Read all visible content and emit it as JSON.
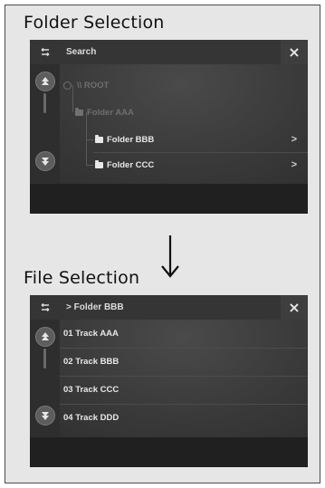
{
  "folder_section": {
    "title": "Folder Selection",
    "screen": {
      "header_title": "Search",
      "close_label": "×",
      "tree": [
        {
          "label": "\\\\ ROOT",
          "dim": true
        },
        {
          "label": "Folder AAA",
          "dim": true
        },
        {
          "label": "Folder BBB",
          "dim": false,
          "chevron": ">"
        },
        {
          "label": "Folder CCC",
          "dim": false,
          "chevron": ">"
        }
      ]
    }
  },
  "file_section": {
    "title": "File Selection",
    "screen": {
      "header_title": "> Folder BBB",
      "close_label": "×",
      "tracks": [
        "01 Track AAA",
        "02 Track BBB",
        "03 Track CCC",
        "04 Track DDD"
      ]
    }
  },
  "icons": {
    "back": "back-arrow-icon",
    "close": "close-icon",
    "scroll_up": "scroll-up-icon",
    "scroll_down": "scroll-down-icon",
    "folder": "folder-icon",
    "transition": "down-arrow-icon"
  }
}
